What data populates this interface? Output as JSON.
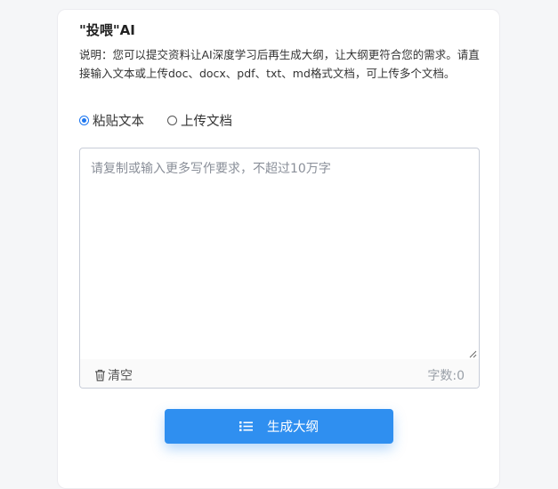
{
  "panel": {
    "title": "\"投喂\"AI",
    "description": "说明：您可以提交资料让AI深度学习后再生成大纲，让大纲更符合您的需求。请直接输入文本或上传doc、docx、pdf、txt、md格式文档，可上传多个文档。"
  },
  "input_mode": {
    "selected": "粘贴文本",
    "options": [
      {
        "label": "粘贴文本",
        "checked": true
      },
      {
        "label": "上传文档",
        "checked": false
      }
    ]
  },
  "editor": {
    "value": "",
    "placeholder": "请复制或输入更多写作要求，不超过10万字",
    "clear_label": "清空",
    "count_label": "字数:0"
  },
  "actions": {
    "generate_label": "生成大纲"
  },
  "colors": {
    "accent": "#2f8ff0",
    "radio_checked": "#1e77f0"
  },
  "icons": [
    "trash-icon",
    "list-icon",
    "resize-grip-icon"
  ]
}
